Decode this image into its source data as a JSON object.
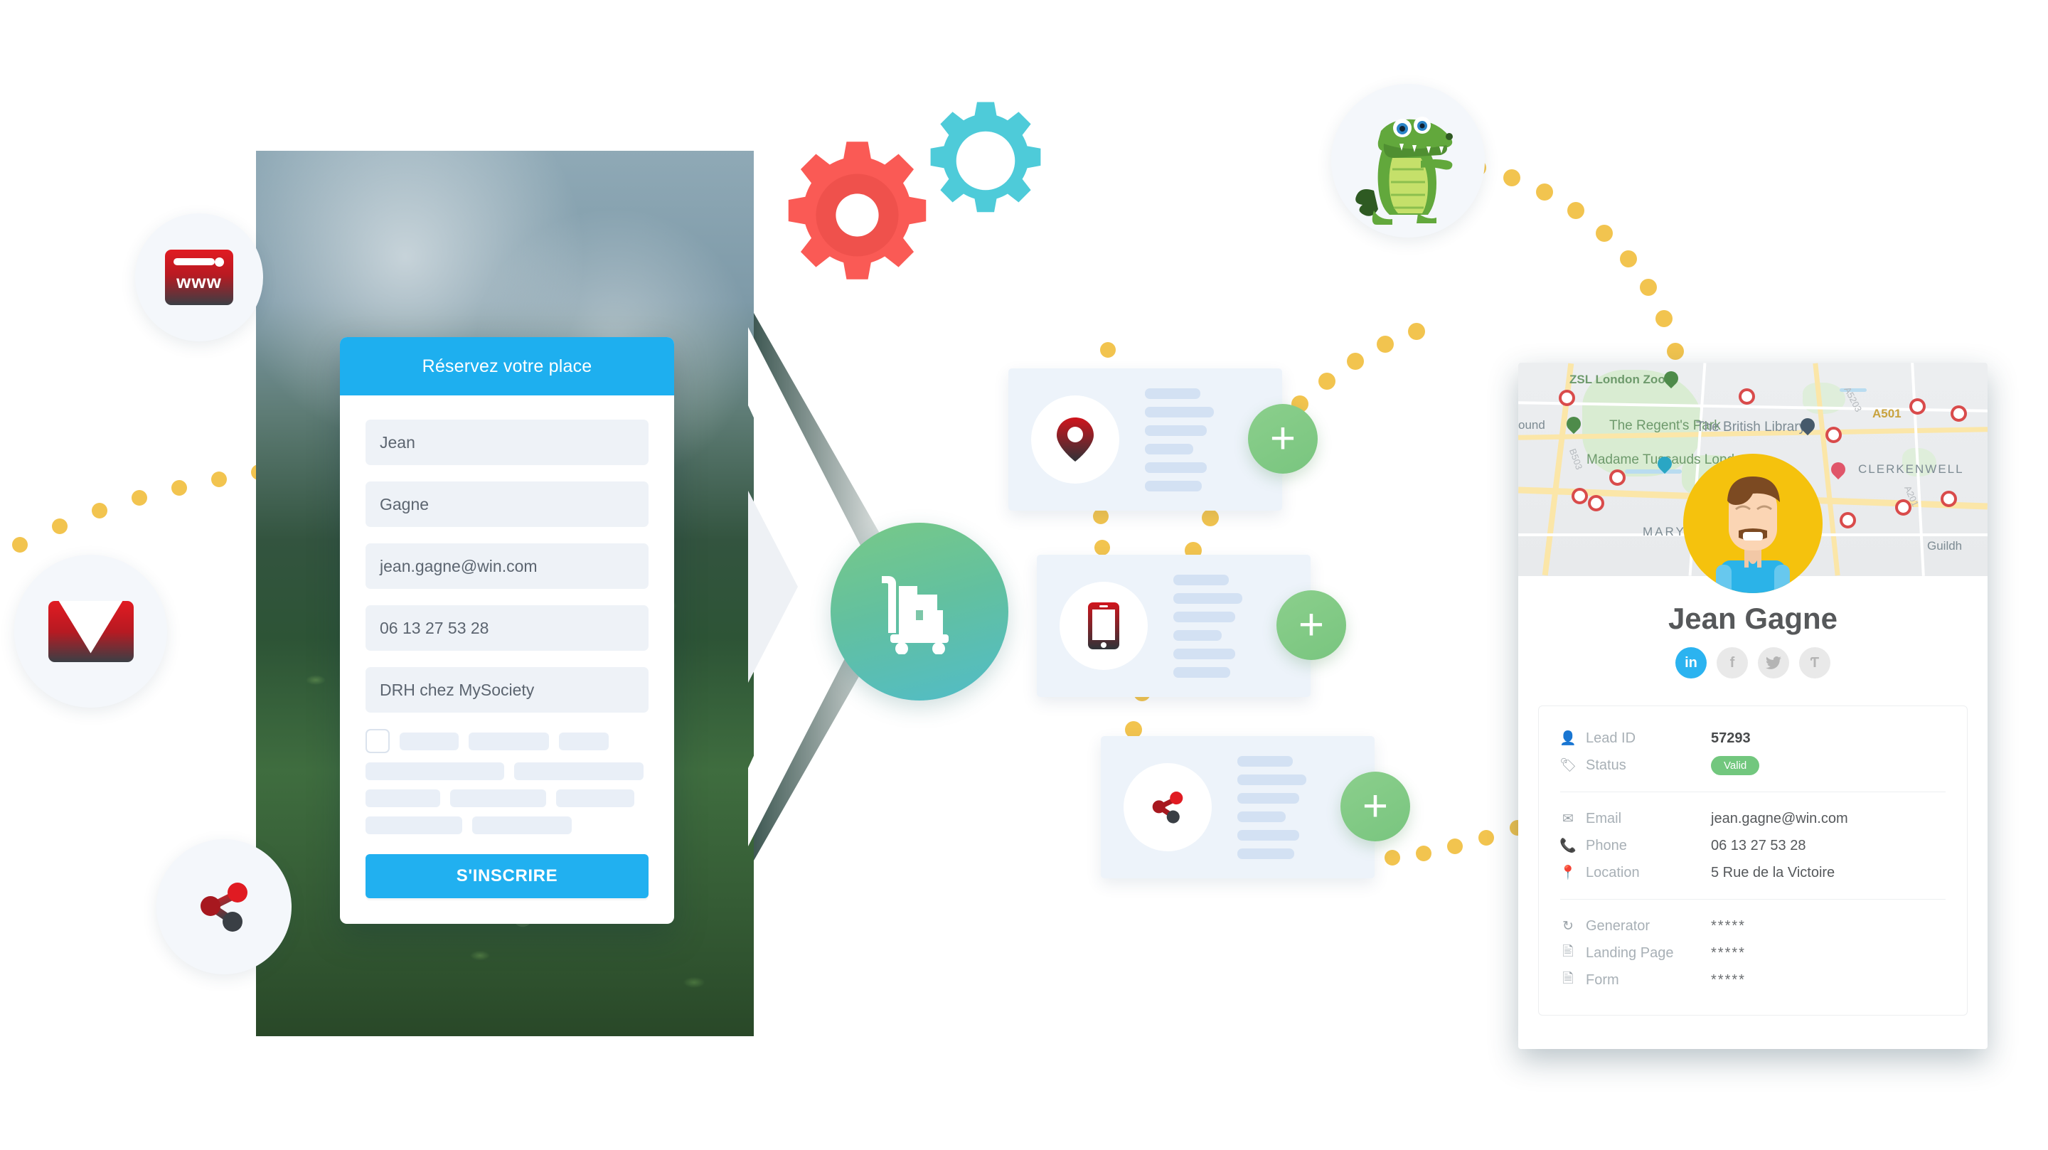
{
  "landing_page": {
    "form": {
      "header_title": "Réservez votre place",
      "fields": [
        {
          "name": "first-name",
          "value": "Jean"
        },
        {
          "name": "last-name",
          "value": "Gagne"
        },
        {
          "name": "email",
          "value": "jean.gagne@win.com"
        },
        {
          "name": "phone",
          "value": "06 13 27 53 28"
        },
        {
          "name": "job-title",
          "value": "DRH chez MySociety"
        }
      ],
      "consent_checkbox_checked": false,
      "submit_label": "S'INSCRIRE"
    }
  },
  "source_icons": [
    {
      "name": "www-icon",
      "label": "www"
    },
    {
      "name": "email-icon",
      "label": ""
    },
    {
      "name": "share-icon",
      "label": ""
    }
  ],
  "processing": {
    "gears": [
      {
        "name": "gear-red",
        "color": "#fa5a55"
      },
      {
        "name": "gear-cyan",
        "color": "#4ecbd9"
      }
    ],
    "mascot": {
      "name": "crocodile-mascot"
    },
    "delivery": {
      "name": "delivery-cart-icon",
      "gradient_from": "#78c987",
      "gradient_to": "#51bcc8"
    }
  },
  "enrichment_cards": [
    {
      "icon": "location-pin-icon",
      "add_label": "+"
    },
    {
      "icon": "mobile-phone-icon",
      "add_label": "+"
    },
    {
      "icon": "share-network-icon",
      "add_label": "+"
    }
  ],
  "lead_card": {
    "map": {
      "labels": [
        "ZSL London Zoo",
        "The Regent's Park",
        "The British Library",
        "Madame Tussauds London",
        "CLERKENWELL",
        "MARYLE",
        "ound",
        "Guildh",
        "A501",
        "A5203",
        "A201",
        "B503"
      ]
    },
    "name": "Jean Gagne",
    "socials": [
      {
        "name": "linkedin",
        "glyph": "in",
        "active": true
      },
      {
        "name": "facebook",
        "glyph": "f",
        "active": false
      },
      {
        "name": "twitter",
        "glyph": "ᵗ",
        "active": false
      },
      {
        "name": "pinterest",
        "glyph": "Ƭ",
        "active": false
      }
    ],
    "details_group_1": [
      {
        "icon": "person-icon",
        "label": "Lead ID",
        "value": "57293",
        "bold": true
      },
      {
        "icon": "tag-icon",
        "label": "Status",
        "value": "Valid",
        "badge": true,
        "badge_color": "#72c77e"
      }
    ],
    "details_group_2": [
      {
        "icon": "envelope-icon",
        "label": "Email",
        "value": "jean.gagne@win.com"
      },
      {
        "icon": "phone-icon",
        "label": "Phone",
        "value": "06 13 27 53 28"
      },
      {
        "icon": "location-pin-icon",
        "label": "Location",
        "value": "5 Rue de la Victoire"
      }
    ],
    "details_group_3": [
      {
        "icon": "generator-icon",
        "label": "Generator",
        "value": "*****"
      },
      {
        "icon": "landing-page-icon",
        "label": "Landing Page",
        "value": "*****"
      },
      {
        "icon": "form-icon",
        "label": "Form",
        "value": "*****"
      }
    ]
  },
  "colors": {
    "accent_blue": "#21b0f0",
    "trail_dot": "#f2c44f",
    "green_add": "#7fc888",
    "red_icon": "#d61c22"
  }
}
